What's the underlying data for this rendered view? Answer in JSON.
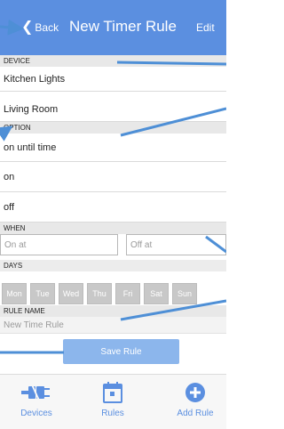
{
  "header": {
    "back_label": "Back",
    "title": "New Timer Rule",
    "edit_label": "Edit"
  },
  "sections": {
    "device": "DEVICE",
    "option": "OPTION",
    "when": "WHEN",
    "days": "DAYS",
    "rule_name": "RULE NAME"
  },
  "devices": [
    "Kitchen Lights",
    "Living Room"
  ],
  "options": [
    "on until time",
    "on",
    "off"
  ],
  "when": {
    "on_placeholder": "On at",
    "off_placeholder": "Off at"
  },
  "days": [
    "Mon",
    "Tue",
    "Wed",
    "Thu",
    "Fri",
    "Sat",
    "Sun"
  ],
  "rule_name": {
    "placeholder": "New Time Rule"
  },
  "save_label": "Save Rule",
  "tabs": [
    {
      "label": "Devices",
      "icon": "plug-icon"
    },
    {
      "label": "Rules",
      "icon": "calendar-icon"
    },
    {
      "label": "Add Rule",
      "icon": "plus-circle-icon"
    }
  ],
  "colors": {
    "accent": "#5b8fe0",
    "save_button": "#8cb6ec",
    "day_button": "#c8c8c8"
  }
}
